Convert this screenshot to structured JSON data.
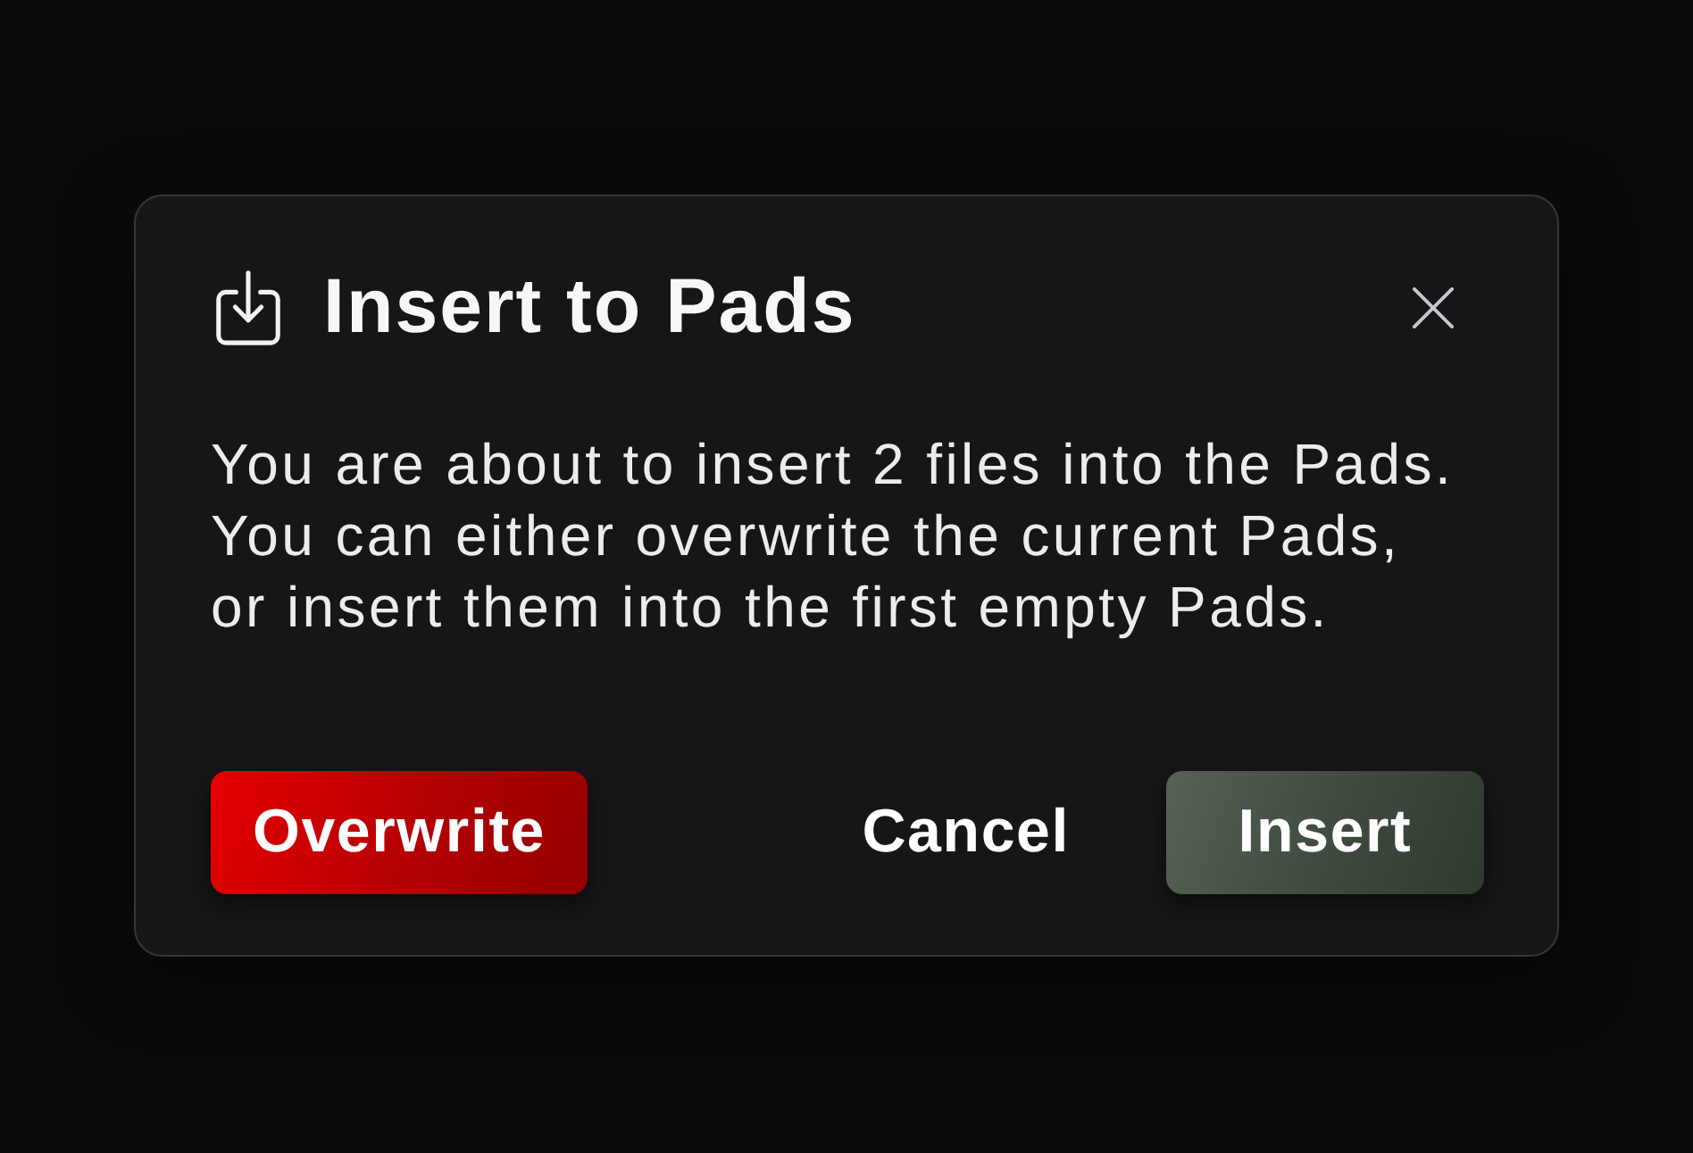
{
  "dialog": {
    "title": "Insert to Pads",
    "message": "You are about to insert 2 files into the Pads.\nYou can either overwrite the current Pads,\nor insert them into the first empty Pads."
  },
  "buttons": [
    {
      "label": "Overwrite",
      "kind": "danger"
    },
    {
      "label": "Cancel",
      "kind": "plain"
    },
    {
      "label": "Insert",
      "kind": "primary"
    }
  ]
}
